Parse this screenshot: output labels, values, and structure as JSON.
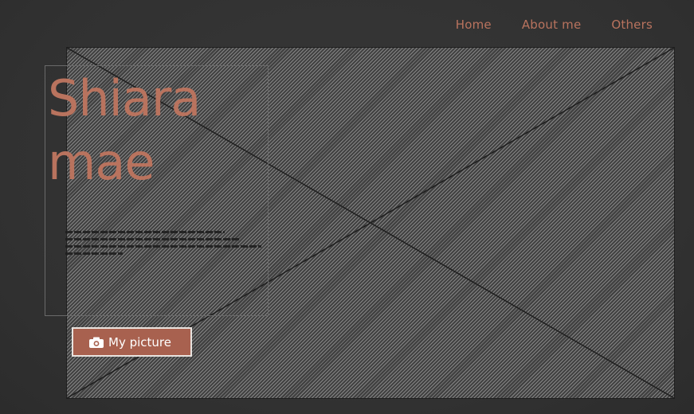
{
  "nav": {
    "items": [
      {
        "label": "Home"
      },
      {
        "label": "About me"
      },
      {
        "label": "Others"
      }
    ]
  },
  "hero": {
    "title_line1": "Shiara",
    "title_line2": "mae"
  },
  "picture_button": {
    "label": "My picture",
    "icon": "camera-icon"
  },
  "colors": {
    "accent": "#b9735e",
    "button_bg": "#a8614f",
    "background": "#343434"
  }
}
